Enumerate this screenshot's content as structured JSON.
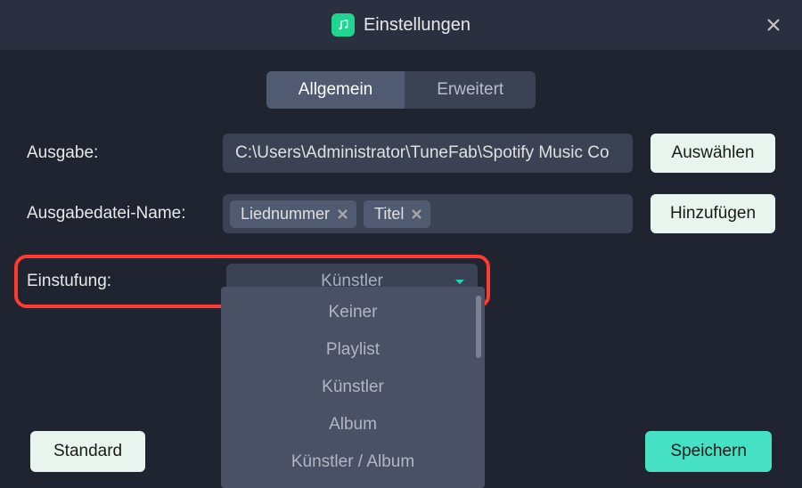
{
  "title": "Einstellungen",
  "tabs": {
    "general": "Allgemein",
    "advanced": "Erweitert"
  },
  "labels": {
    "output": "Ausgabe:",
    "filename": "Ausgabedatei-Name:",
    "classification": "Einstufung:"
  },
  "output_path": "C:\\Users\\Administrator\\TuneFab\\Spotify Music Co",
  "buttons": {
    "choose": "Auswählen",
    "add": "Hinzufügen",
    "default": "Standard",
    "save": "Speichern"
  },
  "filename_chips": [
    "Liednummer",
    "Titel"
  ],
  "classification": {
    "selected": "Künstler",
    "options": [
      "Keiner",
      "Playlist",
      "Künstler",
      "Album",
      "Künstler / Album"
    ]
  }
}
